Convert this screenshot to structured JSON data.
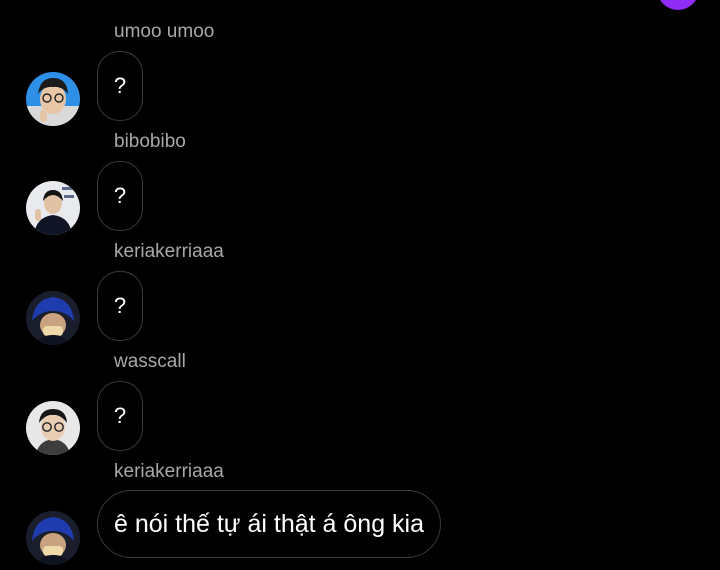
{
  "colors": {
    "background": "#000000",
    "sender_name": "#a8a8a8",
    "bubble_border": "#3a3a3a",
    "message_text": "#ffffff",
    "accent_dot": "#8f2cf5"
  },
  "messages": [
    {
      "sender": "umoo umoo",
      "text": "?",
      "avatar": "avatar-photo-glasses-blue-bg"
    },
    {
      "sender": "bibobibo",
      "text": "?",
      "avatar": "avatar-photo-dark-shirt"
    },
    {
      "sender": "keriakerriaaa",
      "text": "?",
      "avatar": "avatar-photo-blue-hair"
    },
    {
      "sender": "wasscall",
      "text": "?",
      "avatar": "avatar-photo-glasses-light-bg"
    },
    {
      "sender": "keriakerriaaa",
      "text": "ê nói thế tự ái thật á ông kia",
      "avatar": "avatar-photo-blue-hair"
    }
  ]
}
